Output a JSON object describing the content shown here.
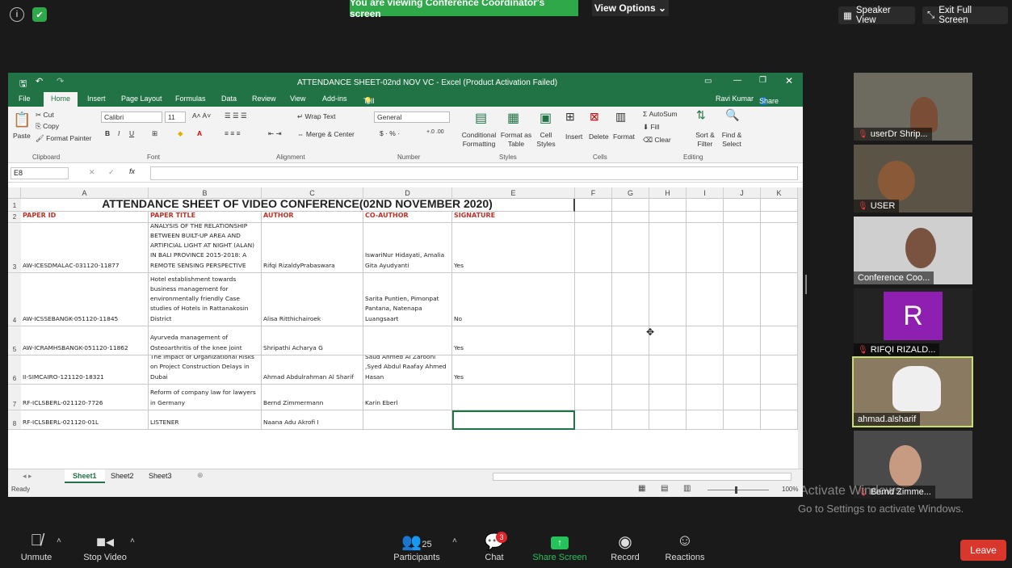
{
  "top": {
    "banner": "You are viewing Conference Coordinator's screen",
    "view_options": "View Options",
    "speaker_view": "Speaker View",
    "exit_full": "Exit Full Screen"
  },
  "excel": {
    "title": "ATTENDANCE SHEET-02nd NOV VC - Excel (Product Activation Failed)",
    "user": "Ravi Kumar",
    "share": "Share",
    "tabs": [
      "File",
      "Home",
      "Insert",
      "Page Layout",
      "Formulas",
      "Data",
      "Review",
      "View",
      "Add-ins"
    ],
    "tell_me": "Tell me what you want to do...",
    "ribbon": {
      "cut": "Cut",
      "copy": "Copy",
      "paste": "Paste",
      "format_painter": "Format Painter",
      "font": "Calibri",
      "size": "11",
      "wrap": "Wrap Text",
      "merge": "Merge & Center",
      "number_format": "General",
      "cond": "Conditional",
      "formatting": "Formatting",
      "format_as": "Format as",
      "table": "Table",
      "cell": "Cell",
      "styles": "Styles",
      "insert": "Insert",
      "delete": "Delete",
      "format": "Format",
      "autosum": "AutoSum",
      "fill": "Fill",
      "clear": "Clear",
      "sort": "Sort &",
      "filter": "Filter",
      "find": "Find &",
      "select": "Select",
      "groups": [
        "Clipboard",
        "Font",
        "Alignment",
        "Number",
        "Styles",
        "Cells",
        "Editing"
      ]
    },
    "name_box": "E8",
    "columns": [
      "A",
      "B",
      "C",
      "D",
      "E",
      "F",
      "G",
      "H",
      "I",
      "J",
      "K"
    ],
    "sheet_title": "ATTENDANCE SHEET OF VIDEO CONFERENCE(02ND NOVEMBER 2020)",
    "headers": [
      "PAPER ID",
      "PAPER TITLE",
      "AUTHOR",
      "CO-AUTHOR",
      "SIGNATURE"
    ],
    "rows": [
      {
        "num": "3",
        "id": "AW-ICESDMALAC-031120-11877",
        "title": "ANALYSIS OF THE RELATIONSHIP BETWEEN BUILT-UP AREA AND ARTIFICIAL LIGHT AT NIGHT (ALAN) IN BALI PROVINCE 2015-2018: A REMOTE SENSING PERSPECTIVE",
        "author": "Rifqi RizaldyPrabaswara",
        "coauthor": "IswariNur Hidayati, Amalia Gita Ayudyanti",
        "sig": "Yes"
      },
      {
        "num": "4",
        "id": "AW-ICSSEBANGK-051120-11845",
        "title": "Corporate Social Responsibility of Hotel establishment towards business management for environmentally friendly Case studies of Hotels in Rattanakosin District",
        "author": "Alisa Ritthichairoek",
        "coauthor": "Sarita Puntien, Pimonpat Pantana, Natenapa Luangsaart",
        "sig": "No"
      },
      {
        "num": "5",
        "id": "AW-ICRAMHSBANGK-051120-11862",
        "title": "Ayurveda management of Osteoarthritis of the knee joint",
        "author": "Shripathi Acharya G",
        "coauthor": "",
        "sig": "Yes"
      },
      {
        "num": "6",
        "id": "II-SIMCAIRO-121120-18321",
        "title": "The Impact of Organizational Risks on Project Construction Delays in Dubai",
        "author": "Ahmad Abdulrahman Al Sharif",
        "coauthor": "Saud Ahmed Al Zarooni ,Syed Abdul Raafay Ahmed Hasan",
        "sig": "Yes"
      },
      {
        "num": "7",
        "id": "RF-ICLSBERL-021120-7726",
        "title": "Reform of company law for lawyers in Germany",
        "author": "Bernd Zimmermann",
        "coauthor": "Karin Eberl",
        "sig": ""
      },
      {
        "num": "8",
        "id": "RF-ICLSBERL-021120-01L",
        "title": "LISTENER",
        "author": "Naana Adu Akrofi I",
        "coauthor": "",
        "sig": ""
      }
    ],
    "sheets": [
      "Sheet1",
      "Sheet2",
      "Sheet3"
    ],
    "status": "Ready",
    "zoom": "100%"
  },
  "participants": [
    "userDr Shrip...",
    "USER",
    "Conference Coo...",
    "RIFQI RIZALD...",
    "ahmad.alsharif",
    "Bernd Zimme..."
  ],
  "avatar_letter": "R",
  "watermark": {
    "line1": "Activate Windows",
    "line2": "Go to Settings to activate Windows."
  },
  "bottom": {
    "unmute": "Unmute",
    "stop_video": "Stop Video",
    "participants_count": "25",
    "participants": "Participants",
    "chat": "Chat",
    "chat_badge": "3",
    "share": "Share Screen",
    "record": "Record",
    "reactions": "Reactions",
    "leave": "Leave"
  }
}
